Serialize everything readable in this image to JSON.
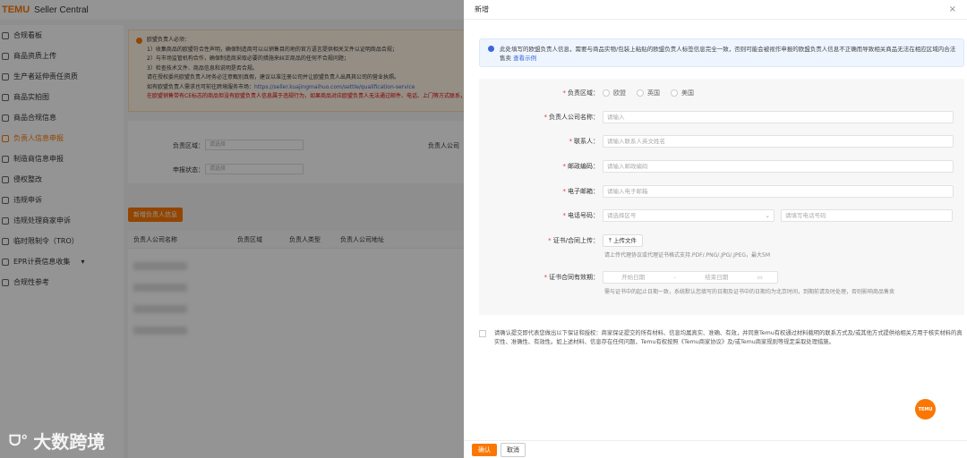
{
  "app": {
    "brand": "TEMU",
    "title": "Seller Central"
  },
  "sidebar": {
    "items": [
      {
        "label": "合规看板"
      },
      {
        "label": "商品资质上传"
      },
      {
        "label": "生产者延伸责任资质"
      },
      {
        "label": "商品实拍图"
      },
      {
        "label": "商品合规信息"
      },
      {
        "label": "负责人信息申报"
      },
      {
        "label": "制造商信息申报"
      },
      {
        "label": "侵权整改"
      },
      {
        "label": "违规申诉"
      },
      {
        "label": "违规处理商家申诉"
      },
      {
        "label": "临时限制令（TRO）"
      },
      {
        "label": "EPR计费信息收集"
      },
      {
        "label": "合规性参考"
      }
    ]
  },
  "notice": {
    "title": "欧盟负责人必须：",
    "l1": "1）收集商品的欧盟符合性声明，确保制造商可以以销售目的地的官方语言提供相关文件以证明商品合规；",
    "l2": "2）与市场监管机构合作，确保制造商采取必要的措施来纠正商品的任何不合规问题；",
    "l3": "3）检查技术文件、商品信息和说明是否合规。",
    "l4": "请在授权委托欧盟负责人时务必注意甄别真假，建议以准注册公司并让欧盟负责人出具其公司的营业执照。",
    "l5": "如有欧盟负责人需求也可前往跨境服务市场：",
    "link": "https://seller.kuajingmaihuo.com/settle/qualification-service",
    "red": "在欧盟销售带有CE标志的商品但没有欧盟负责人信息属于违规行为，如果商品对应欧盟负责人无法通过邮件、电话、上门等方式联系，商品将面临下架风险，请遵守相关法规处理措施。"
  },
  "filter": {
    "region_label": "负责区域：",
    "region_ph": "请选择",
    "status_label": "申报状态：",
    "status_ph": "请选择",
    "company_label": "负责人公司"
  },
  "add_button": "新增负责人信息",
  "table": {
    "headers": [
      "负责人公司名称",
      "负责区域",
      "负责人类型",
      "负责人公司地址"
    ]
  },
  "watermark": "大数跨境",
  "drawer": {
    "title": "新增",
    "close": "×",
    "info": "此处填写的欧盟负责人信息，需要与商品实物/包装上粘贴的欧盟负责人标签信息完全一致，否则可能会被视作申报的欧盟负责人信息不正确而导致相关商品无法在相应区域内合法售卖",
    "info_link": "查看示例",
    "region": {
      "label": "负责区域：",
      "options": [
        "欧盟",
        "英国",
        "美国"
      ]
    },
    "company": {
      "label": "负责人公司名称：",
      "ph": "请输入"
    },
    "contact": {
      "label": "联系人：",
      "ph": "请输入联系人英文姓名"
    },
    "postal": {
      "label": "邮政编码：",
      "ph": "请输入邮政编码"
    },
    "email": {
      "label": "电子邮箱：",
      "ph": "请输入电子邮箱"
    },
    "phone": {
      "label": "电话号码：",
      "area_ph": "请选择区号",
      "ph": "请填写电话号码"
    },
    "upload": {
      "label": "证书/合同上传：",
      "button": "上传文件",
      "hint": "请上传代理协议或代理证书格式支持.PDF/.PNG/.JPG/.JPEG，最大5M"
    },
    "validity": {
      "label": "证书合同有效期：",
      "start": "开始日期",
      "sep": "-",
      "end": "结束日期",
      "hint": "需与证书中的起止日期一致，系统默认您填写的日期及证书中的日期均为北京时间，到期前请及时处理，否则影响商品售卖"
    },
    "agree": "请确认提交即代表您做出以下保证和授权：商家保证提交的所有材料、信息均属真实、准确、有效，并同意Temu有权通过材料载明的联系方式及/或其他方式提供给相关方用于核实材料的真实性、准确性、有效性。如上述材料、信息存在任何问题，Temu有权按照《Temu商家协议》及/或Temu商家规则等规定采取处理措施。",
    "confirm": "确认",
    "cancel": "取消"
  },
  "fab": "TEMU",
  "colors": {
    "accent": "#fb7701",
    "link": "#3a67d8"
  }
}
